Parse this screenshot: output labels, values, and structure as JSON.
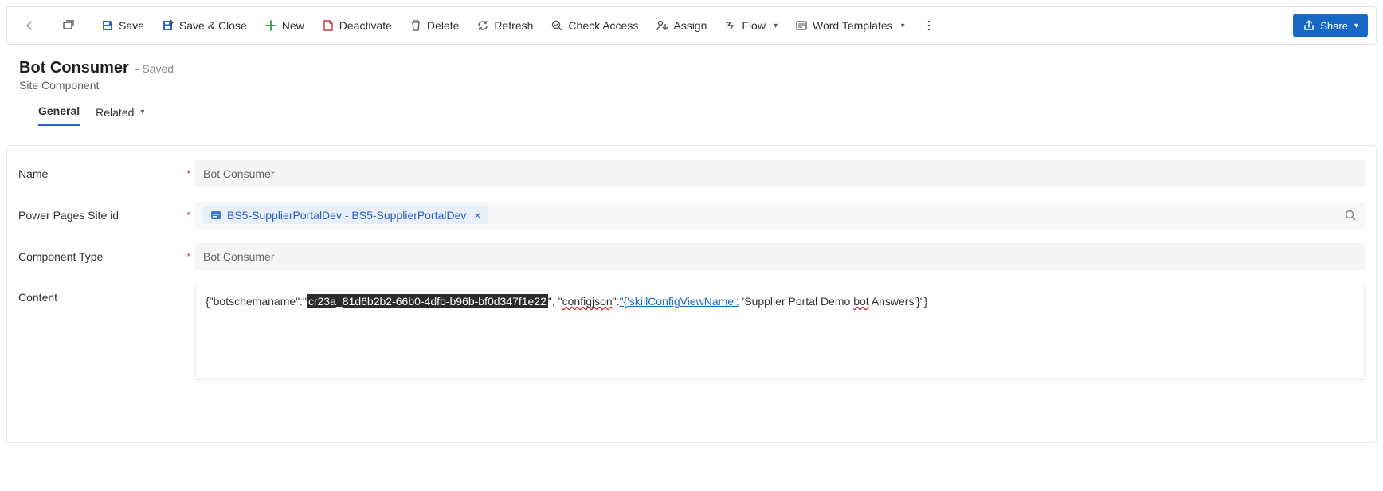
{
  "toolbar": {
    "back": "",
    "open_new": "",
    "save": "Save",
    "save_close": "Save & Close",
    "new": "New",
    "deactivate": "Deactivate",
    "delete": "Delete",
    "refresh": "Refresh",
    "check_access": "Check Access",
    "assign": "Assign",
    "flow": "Flow",
    "word_templates": "Word Templates",
    "share": "Share"
  },
  "header": {
    "title": "Bot Consumer",
    "status": "- Saved",
    "entity": "Site Component"
  },
  "tabs": {
    "general": "General",
    "related": "Related"
  },
  "form": {
    "name_label": "Name",
    "name_value": "Bot Consumer",
    "site_label": "Power Pages Site id",
    "site_chip": "BS5-SupplierPortalDev - BS5-SupplierPortalDev",
    "component_type_label": "Component Type",
    "component_type_value": "Bot Consumer",
    "content_label": "Content",
    "content": {
      "prefix": "{\"botschemaname\":\"",
      "selected": "cr23a_81d6b2b2-66b0-4dfb-b96b-bf0d347f1e22",
      "mid1": "\", \"",
      "key2": "configjson",
      "mid2": "\":",
      "val2a": "\"{",
      "val2b": "'skillConfigViewName'",
      "val2c": ":",
      "mid3": " 'Supplier Portal Demo ",
      "bot_word": "bot",
      "suffix": " Answers'}\"}"
    }
  }
}
